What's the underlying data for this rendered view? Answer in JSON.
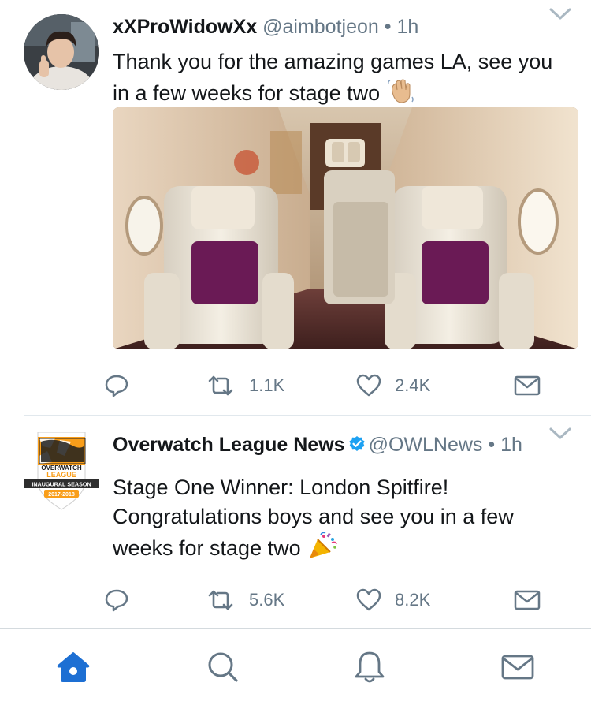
{
  "colors": {
    "accent": "#1da1f2",
    "text_primary": "#14171a",
    "text_secondary": "#657786",
    "divider": "#e1e8ed",
    "home_active": "#1d6fd3",
    "owl_orange": "#f99e1a"
  },
  "tweets": [
    {
      "name": "xXProWidowXx",
      "handle": "@aimbotjeon",
      "dot": "•",
      "time": "1h",
      "text": "Thank you for the amazing games LA, see you in a few weeks for stage two",
      "emoji": "waving-hand-emoji",
      "has_media": true,
      "media_icon": "private-jet-cabin-photo",
      "counts": {
        "retweets": "1.1K",
        "likes": "2.4K"
      }
    },
    {
      "name": "Overwatch League News",
      "verified": true,
      "handle": "@OWLNews",
      "dot": "•",
      "time": "1h",
      "text": "Stage One Winner: London Spitfire! Congratulations boys and see you in a few weeks for stage two",
      "emoji": "party-popper-emoji",
      "avatar": {
        "line1": "OVERWATCH",
        "line2": "LEAGUE",
        "line3": "INAUGURAL SEASON",
        "line4": "2017-2018"
      },
      "counts": {
        "retweets": "5.6K",
        "likes": "8.2K"
      }
    }
  ],
  "tabbar": {
    "items": [
      {
        "id": "home",
        "icon": "home-icon",
        "active": true
      },
      {
        "id": "search",
        "icon": "search-icon",
        "active": false
      },
      {
        "id": "notifications",
        "icon": "bell-icon",
        "active": false
      },
      {
        "id": "messages",
        "icon": "envelope-icon",
        "active": false
      }
    ]
  }
}
